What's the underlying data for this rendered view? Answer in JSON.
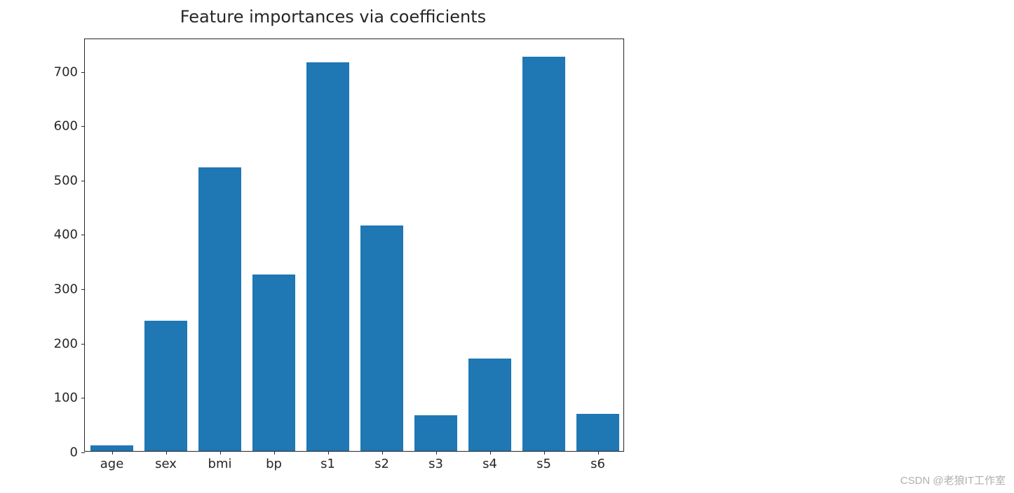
{
  "chart_data": {
    "type": "bar",
    "title": "Feature importances via coefficients",
    "categories": [
      "age",
      "sex",
      "bmi",
      "bp",
      "s1",
      "s2",
      "s3",
      "s4",
      "s5",
      "s6"
    ],
    "values": [
      10,
      240,
      522,
      325,
      715,
      415,
      66,
      170,
      725,
      68
    ],
    "xlabel": "",
    "ylabel": "",
    "ylim": [
      0,
      760
    ],
    "yticks": [
      0,
      100,
      200,
      300,
      400,
      500,
      600,
      700
    ],
    "bar_color": "#1f77b4"
  },
  "watermark": "CSDN @老狼IT工作室"
}
